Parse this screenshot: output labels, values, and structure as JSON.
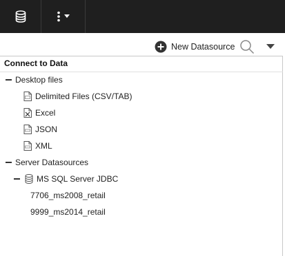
{
  "topbar": {
    "datasource_icon": "database-icon",
    "more_icon": "vertical-ellipsis-icon",
    "more_dropdown_icon": "caret-down-icon"
  },
  "toolbar": {
    "new_datasource_label": "New Datasource",
    "new_datasource_icon": "plus-circle-icon",
    "search_icon": "search-icon",
    "dropdown_icon": "caret-down-icon"
  },
  "panel": {
    "title": "Connect to Data",
    "tree": {
      "desktop": {
        "label": "Desktop files",
        "items": [
          {
            "label": "Delimited Files (CSV/TAB)",
            "icon": "csv-file-icon"
          },
          {
            "label": "Excel",
            "icon": "excel-file-icon"
          },
          {
            "label": "JSON",
            "icon": "json-file-icon"
          },
          {
            "label": "XML",
            "icon": "xml-file-icon"
          }
        ]
      },
      "server": {
        "label": "Server Datasources",
        "connections": [
          {
            "label": "MS SQL Server JDBC",
            "icon": "database-icon",
            "databases": [
              "7706_ms2008_retail",
              "9999_ms2014_retail"
            ]
          }
        ]
      }
    }
  },
  "colors": {
    "topbar_bg": "#1f1f1f",
    "icon_dark": "#444444",
    "border": "#c8c8c8"
  }
}
